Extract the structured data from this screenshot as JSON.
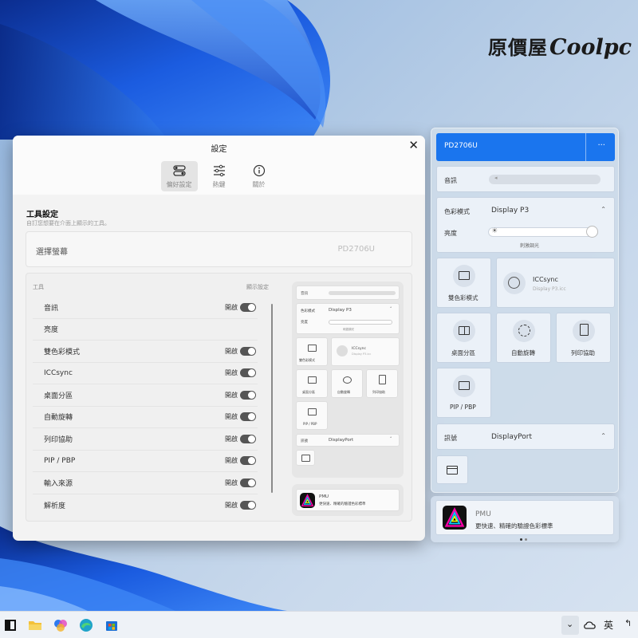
{
  "brand": {
    "text_cn": "原價屋",
    "text_en": "Coolpc"
  },
  "settings": {
    "title": "設定",
    "tabs": [
      {
        "label": "偏好設定",
        "icon": "toggles-icon",
        "active": true
      },
      {
        "label": "熱鍵",
        "icon": "sliders-icon",
        "active": false
      },
      {
        "label": "關於",
        "icon": "info-icon",
        "active": false
      }
    ],
    "section_title": "工具設定",
    "section_subtitle": "自訂您想要在介面上顯示的工具。",
    "monitor_label": "選擇螢幕",
    "monitor_value": "PD2706U",
    "col_tool": "工具",
    "col_display": "顯示設定",
    "tools": [
      {
        "name": "音訊",
        "state": "開啟",
        "on": true
      },
      {
        "name": "亮度",
        "state": "",
        "on": false
      },
      {
        "name": "雙色彩模式",
        "state": "開啟",
        "on": true
      },
      {
        "name": "ICCsync",
        "state": "開啟",
        "on": true
      },
      {
        "name": "桌面分區",
        "state": "開啟",
        "on": true
      },
      {
        "name": "自動旋轉",
        "state": "開啟",
        "on": true
      },
      {
        "name": "列印協助",
        "state": "開啟",
        "on": true
      },
      {
        "name": "PIP / PBP",
        "state": "開啟",
        "on": true
      },
      {
        "name": "輸入來源",
        "state": "開啟",
        "on": true
      },
      {
        "name": "解析度",
        "state": "開啟",
        "on": true
      }
    ],
    "preview": {
      "audio": "音訊",
      "color_mode": "色彩模式",
      "color_mode_value": "Display P3",
      "brightness": "亮度",
      "brightness_note": "刺激調光",
      "dual_color": "雙色彩模式",
      "icc_title": "ICCsync",
      "icc_sub": "Display P3.icc",
      "desktop_partition": "桌面分區",
      "auto_rotate": "自動旋轉",
      "print_assist": "列印協助",
      "pip": "PIP / PBP",
      "input": "訊號",
      "input_value": "DisplayPort",
      "pmu_title": "PMU",
      "pmu_sub": "更快速、精確的驗證色彩標準"
    }
  },
  "panel": {
    "header_title": "PD2706U",
    "more": "···",
    "audio_label": "音訊",
    "color_mode_label": "色彩模式",
    "color_mode_value": "Display P3",
    "brightness_label": "亮度",
    "brightness_note": "刺激調光",
    "brightness_level": 1.0,
    "tiles": [
      {
        "label": "雙色彩模式",
        "icon": "monitor-icon"
      },
      {
        "label": "ICCsync",
        "sub": "Display P3.icc",
        "icon": "palette-icon"
      },
      {
        "label": "桌面分區",
        "icon": "split-screen-icon"
      },
      {
        "label": "自動旋轉",
        "icon": "rotate-icon"
      },
      {
        "label": "列印協助",
        "icon": "print-page-icon"
      },
      {
        "label": "PIP / PBP",
        "icon": "pip-icon"
      }
    ],
    "input_label": "訊號",
    "input_value": "DisplayPort",
    "pmu_title": "PMU",
    "pmu_sub": "更快速、精確的驗證色彩標準"
  },
  "taskbar": {
    "apps": [
      "start-icon",
      "file-explorer-icon",
      "copilot-icon",
      "edge-icon",
      "store-icon"
    ],
    "tray_lang": "英"
  },
  "colors": {
    "accent": "#1a75ee",
    "toggle_on": "#555555"
  }
}
